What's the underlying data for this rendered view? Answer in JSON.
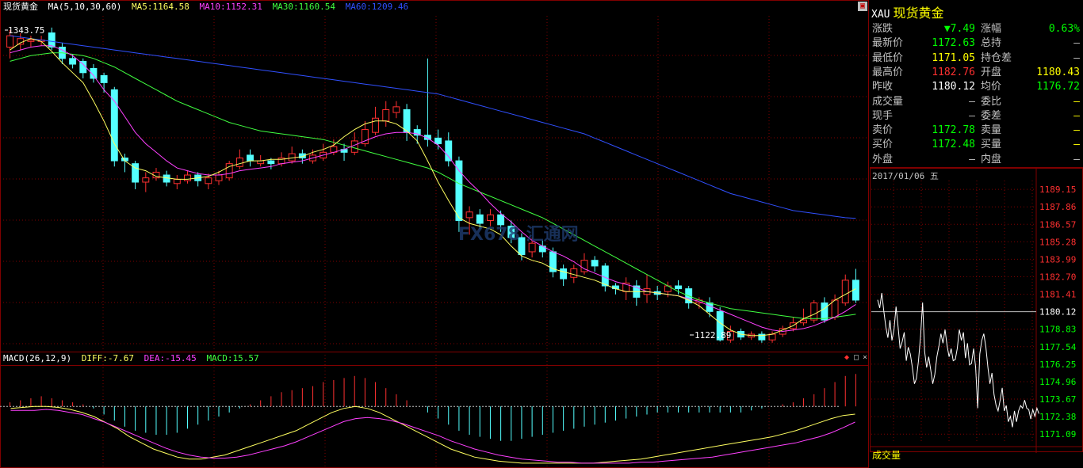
{
  "header": {
    "instrument": "现货黄金",
    "ma_params": "MA(5,10,30,60)",
    "ma5": "MA5:1164.58",
    "ma10": "MA10:1152.31",
    "ma30": "MA30:1160.54",
    "ma60": "MA60:1209.46"
  },
  "annotations": {
    "high_label": "1343.75",
    "low_label": "1122.89"
  },
  "macd_header": {
    "params": "MACD(26,12,9)",
    "diff": "DIFF:-7.67",
    "dea": "DEA:-15.45",
    "macd": "MACD:15.57"
  },
  "quote": {
    "code": "XAU",
    "name": "现货黄金",
    "rows": [
      {
        "l1": "涨跌",
        "v1": "▼7.49",
        "c1": "#00ff00",
        "l2": "涨幅",
        "v2": "0.63%",
        "c2": "#00ff00"
      },
      {
        "l1": "最新价",
        "v1": "1172.63",
        "c1": "#00ff00",
        "l2": "总持",
        "v2": "—",
        "c2": "#c0c0c0"
      },
      {
        "l1": "最低价",
        "v1": "1171.05",
        "c1": "#ffff00",
        "l2": "持仓差",
        "v2": "—",
        "c2": "#c0c0c0"
      },
      {
        "l1": "最高价",
        "v1": "1182.76",
        "c1": "#ff3030",
        "l2": "开盘",
        "v2": "1180.43",
        "c2": "#ffff00"
      },
      {
        "l1": "昨收",
        "v1": "1180.12",
        "c1": "#ffffff",
        "l2": "均价",
        "v2": "1176.72",
        "c2": "#00ff00"
      },
      {
        "l1": "成交量",
        "v1": "—",
        "c1": "#c0c0c0",
        "l2": "委比",
        "v2": "—",
        "c2": "#ffff00"
      },
      {
        "l1": "现手",
        "v1": "—",
        "c1": "#c0c0c0",
        "l2": "委差",
        "v2": "—",
        "c2": "#ffff00"
      },
      {
        "l1": "卖价",
        "v1": "1172.78",
        "c1": "#00ff00",
        "l2": "卖量",
        "v2": "—",
        "c2": "#ffff00"
      },
      {
        "l1": "买价",
        "v1": "1172.48",
        "c1": "#00ff00",
        "l2": "买量",
        "v2": "—",
        "c2": "#ffff00"
      },
      {
        "l1": "外盘",
        "v1": "—",
        "c1": "#c0c0c0",
        "l2": "内盘",
        "v2": "—",
        "c2": "#c0c0c0"
      }
    ]
  },
  "mini": {
    "date": "2017/01/06 五",
    "volume_label": "成交量",
    "watermark": "FX678 汇通网"
  },
  "colors": {
    "up": "#ff3030",
    "down": "#54ffff",
    "ma5": "#ffff60",
    "ma10": "#ff40ff",
    "ma30": "#40ff40",
    "ma60": "#3050ff",
    "grid": "#800000"
  },
  "chart_data": [
    {
      "type": "candlestick",
      "title": "现货黄金",
      "ylim": [
        1118,
        1352
      ],
      "candles": [
        [
          1330,
          1338,
          1322,
          1342
        ],
        [
          1332,
          1336,
          1328,
          1340
        ],
        [
          1334,
          1335,
          1330,
          1338
        ],
        [
          1334,
          1335,
          1331,
          1338
        ],
        [
          1340,
          1330,
          1328,
          1343.75
        ],
        [
          1330,
          1322,
          1318,
          1333
        ],
        [
          1322,
          1318,
          1315,
          1325
        ],
        [
          1320,
          1312,
          1308,
          1322
        ],
        [
          1315,
          1308,
          1305,
          1318
        ],
        [
          1310,
          1305,
          1298,
          1312
        ],
        [
          1300,
          1250,
          1246,
          1302
        ],
        [
          1252,
          1250,
          1242,
          1255
        ],
        [
          1248,
          1235,
          1230,
          1250
        ],
        [
          1235,
          1238,
          1228,
          1242
        ],
        [
          1238,
          1242,
          1236,
          1245
        ],
        [
          1240,
          1235,
          1232,
          1243
        ],
        [
          1234,
          1237,
          1230,
          1240
        ],
        [
          1236,
          1240,
          1234,
          1243
        ],
        [
          1240,
          1236,
          1232,
          1242
        ],
        [
          1234,
          1238,
          1230,
          1241
        ],
        [
          1236,
          1240,
          1233,
          1243
        ],
        [
          1238,
          1248,
          1236,
          1250
        ],
        [
          1246,
          1252,
          1244,
          1258
        ],
        [
          1254,
          1250,
          1246,
          1258
        ],
        [
          1248,
          1250,
          1246,
          1254
        ],
        [
          1250,
          1248,
          1244,
          1252
        ],
        [
          1248,
          1252,
          1246,
          1256
        ],
        [
          1250,
          1255,
          1248,
          1260
        ],
        [
          1255,
          1252,
          1248,
          1258
        ],
        [
          1250,
          1254,
          1248,
          1258
        ],
        [
          1252,
          1256,
          1250,
          1262
        ],
        [
          1256,
          1260,
          1254,
          1265
        ],
        [
          1258,
          1256,
          1250,
          1262
        ],
        [
          1256,
          1264,
          1254,
          1270
        ],
        [
          1262,
          1272,
          1260,
          1278
        ],
        [
          1270,
          1280,
          1268,
          1288
        ],
        [
          1278,
          1286,
          1274,
          1292
        ],
        [
          1284,
          1288,
          1280,
          1292
        ],
        [
          1286,
          1270,
          1264,
          1290
        ],
        [
          1272,
          1268,
          1262,
          1275
        ],
        [
          1268,
          1265,
          1260,
          1322
        ],
        [
          1266,
          1262,
          1258,
          1272
        ],
        [
          1264,
          1250,
          1246,
          1270
        ],
        [
          1250,
          1208,
          1200,
          1253
        ],
        [
          1210,
          1214,
          1198,
          1218
        ],
        [
          1212,
          1206,
          1202,
          1216
        ],
        [
          1208,
          1212,
          1204,
          1216
        ],
        [
          1212,
          1205,
          1200,
          1215
        ],
        [
          1204,
          1196,
          1192,
          1208
        ],
        [
          1196,
          1184,
          1180,
          1199
        ],
        [
          1186,
          1192,
          1182,
          1196
        ],
        [
          1190,
          1186,
          1182,
          1194
        ],
        [
          1186,
          1172,
          1168,
          1189
        ],
        [
          1174,
          1167,
          1162,
          1177
        ],
        [
          1168,
          1174,
          1164,
          1177
        ],
        [
          1172,
          1180,
          1170,
          1185
        ],
        [
          1180,
          1176,
          1172,
          1183
        ],
        [
          1176,
          1162,
          1158,
          1178
        ],
        [
          1162,
          1160,
          1156,
          1164
        ],
        [
          1158,
          1164,
          1152,
          1168
        ],
        [
          1162,
          1154,
          1148,
          1166
        ],
        [
          1156,
          1160,
          1150,
          1170
        ],
        [
          1158,
          1156,
          1152,
          1162
        ],
        [
          1158,
          1162,
          1154,
          1165
        ],
        [
          1162,
          1160,
          1156,
          1166
        ],
        [
          1160,
          1150,
          1146,
          1162
        ],
        [
          1150,
          1152,
          1146,
          1154
        ],
        [
          1150,
          1144,
          1140,
          1154
        ],
        [
          1144,
          1124,
          1122.89,
          1147
        ],
        [
          1124,
          1130,
          1122,
          1134
        ],
        [
          1130,
          1126,
          1124,
          1132
        ],
        [
          1126,
          1128,
          1124,
          1130
        ],
        [
          1128,
          1124,
          1122,
          1130
        ],
        [
          1124,
          1128,
          1122,
          1130
        ],
        [
          1128,
          1132,
          1126,
          1134
        ],
        [
          1132,
          1136,
          1130,
          1140
        ],
        [
          1136,
          1138,
          1134,
          1146
        ],
        [
          1138,
          1150,
          1136,
          1152
        ],
        [
          1150,
          1138,
          1136,
          1154
        ],
        [
          1140,
          1152,
          1138,
          1156
        ],
        [
          1150,
          1166,
          1148,
          1170
        ],
        [
          1166,
          1152,
          1150,
          1174
        ]
      ],
      "ma5": [
        1328,
        1333,
        1336,
        1334,
        1327,
        1319,
        1312,
        1305,
        1292,
        1278,
        1262,
        1250,
        1245,
        1243,
        1239,
        1238,
        1237,
        1237,
        1238,
        1239,
        1242,
        1246,
        1248,
        1250,
        1250,
        1251,
        1251,
        1252,
        1253,
        1256,
        1258,
        1261,
        1267,
        1272,
        1276,
        1278,
        1278,
        1276,
        1271,
        1264,
        1250,
        1235,
        1222,
        1210,
        1206,
        1204,
        1202,
        1198,
        1190,
        1183,
        1180,
        1178,
        1174,
        1172,
        1170,
        1168,
        1166,
        1163,
        1160,
        1158,
        1158,
        1158,
        1157,
        1156,
        1155,
        1152,
        1148,
        1142,
        1136,
        1131,
        1128,
        1127,
        1127,
        1128,
        1131,
        1134,
        1139,
        1142,
        1146,
        1152,
        1156,
        1160
      ],
      "ma10": [
        1326,
        1328,
        1330,
        1331,
        1331,
        1328,
        1324,
        1318,
        1310,
        1300,
        1292,
        1281,
        1270,
        1262,
        1256,
        1250,
        1245,
        1243,
        1241,
        1240,
        1240,
        1241,
        1243,
        1244,
        1245,
        1246,
        1248,
        1249,
        1250,
        1252,
        1254,
        1256,
        1258,
        1261,
        1264,
        1267,
        1269,
        1270,
        1270,
        1269,
        1266,
        1261,
        1253,
        1243,
        1235,
        1228,
        1220,
        1213,
        1207,
        1200,
        1194,
        1190,
        1186,
        1183,
        1179,
        1174,
        1171,
        1168,
        1165,
        1163,
        1161,
        1158,
        1157,
        1156,
        1155,
        1153,
        1151,
        1148,
        1145,
        1142,
        1139,
        1136,
        1133,
        1131,
        1130,
        1131,
        1132,
        1134,
        1137,
        1140,
        1144,
        1149
      ],
      "ma30": [
        1320,
        1322,
        1324,
        1325,
        1326,
        1326,
        1325,
        1324,
        1322,
        1319,
        1316,
        1312,
        1308,
        1304,
        1300,
        1296,
        1292,
        1289,
        1286,
        1283,
        1280,
        1277,
        1275,
        1273,
        1271,
        1270,
        1269,
        1268,
        1267,
        1266,
        1265,
        1263,
        1261,
        1259,
        1257,
        1255,
        1253,
        1251,
        1249,
        1247,
        1245,
        1242,
        1238,
        1234,
        1231,
        1228,
        1225,
        1222,
        1219,
        1216,
        1213,
        1210,
        1206,
        1202,
        1198,
        1194,
        1190,
        1186,
        1182,
        1178,
        1174,
        1170,
        1166,
        1162,
        1158,
        1155,
        1152,
        1150,
        1148,
        1146,
        1145,
        1144,
        1143,
        1142,
        1141,
        1140,
        1139,
        1139,
        1139,
        1140,
        1141,
        1142
      ],
      "ma60": [
        1338,
        1337,
        1336,
        1335,
        1334,
        1333,
        1332,
        1331,
        1330,
        1329,
        1328,
        1327,
        1326,
        1325,
        1324,
        1323,
        1322,
        1321,
        1320,
        1319,
        1318,
        1317,
        1316,
        1315,
        1314,
        1313,
        1312,
        1311,
        1310,
        1309,
        1308,
        1307,
        1306,
        1305,
        1304,
        1303,
        1302,
        1301,
        1300,
        1299,
        1298,
        1297,
        1295,
        1293,
        1291,
        1289,
        1287,
        1285,
        1283,
        1281,
        1279,
        1277,
        1275,
        1273,
        1271,
        1269,
        1266,
        1263,
        1260,
        1257,
        1254,
        1251,
        1248,
        1245,
        1242,
        1239,
        1236,
        1233,
        1230,
        1227,
        1225,
        1223,
        1221,
        1219,
        1217,
        1215,
        1214,
        1213,
        1212,
        1211,
        1210,
        1209.46
      ]
    },
    {
      "type": "bar",
      "title": "MACD(26,12,9)",
      "ylim": [
        -60,
        40
      ],
      "macd": [
        4,
        6,
        8,
        10,
        8,
        6,
        4,
        2,
        -2,
        -8,
        -14,
        -20,
        -24,
        -26,
        -28,
        -28,
        -26,
        -22,
        -18,
        -14,
        -10,
        -6,
        -2,
        2,
        6,
        10,
        14,
        16,
        18,
        20,
        24,
        26,
        28,
        30,
        28,
        24,
        18,
        12,
        6,
        0,
        -6,
        -12,
        -18,
        -24,
        -28,
        -30,
        -32,
        -34,
        -34,
        -32,
        -30,
        -28,
        -26,
        -24,
        -22,
        -20,
        -18,
        -16,
        -14,
        -12,
        -10,
        -8,
        -6,
        -6,
        -6,
        -6,
        -6,
        -6,
        -6,
        -6,
        -6,
        -4,
        -2,
        0,
        2,
        4,
        8,
        12,
        18,
        24,
        30,
        32
      ],
      "diff": [
        -2,
        -1,
        0,
        0,
        -1,
        -3,
        -6,
        -10,
        -16,
        -22,
        -30,
        -36,
        -42,
        -46,
        -50,
        -52,
        -52,
        -50,
        -48,
        -44,
        -40,
        -36,
        -32,
        -28,
        -24,
        -18,
        -12,
        -6,
        -2,
        0,
        -2,
        -6,
        -12,
        -18,
        -24,
        -30,
        -36,
        -42,
        -46,
        -50,
        -52,
        -54,
        -55,
        -56,
        -56,
        -56,
        -56,
        -56,
        -56,
        -56,
        -55,
        -54,
        -53,
        -52,
        -50,
        -48,
        -46,
        -44,
        -42,
        -40,
        -38,
        -36,
        -34,
        -32,
        -30,
        -27,
        -24,
        -20,
        -16,
        -12,
        -9,
        -7.67
      ],
      "dea": [
        -4,
        -4,
        -4,
        -3,
        -4,
        -6,
        -8,
        -12,
        -16,
        -21,
        -26,
        -31,
        -36,
        -41,
        -45,
        -48,
        -50,
        -51,
        -51,
        -50,
        -48,
        -45,
        -42,
        -39,
        -35,
        -30,
        -25,
        -20,
        -15,
        -12,
        -11,
        -12,
        -14,
        -17,
        -21,
        -25,
        -29,
        -34,
        -38,
        -42,
        -45,
        -48,
        -50,
        -52,
        -53,
        -54,
        -55,
        -55,
        -56,
        -56,
        -56,
        -56,
        -56,
        -55,
        -55,
        -54,
        -53,
        -52,
        -51,
        -50,
        -48,
        -46,
        -44,
        -42,
        -40,
        -38,
        -36,
        -33,
        -30,
        -26,
        -21,
        -15.45
      ]
    },
    {
      "type": "line",
      "title": "2017/01/06 五",
      "yticks": [
        "1189.15",
        "1187.86",
        "1186.57",
        "1185.28",
        "1183.99",
        "1182.70",
        "1181.41",
        "1180.12",
        "1178.83",
        "1177.54",
        "1176.25",
        "1174.96",
        "1173.67",
        "1172.38",
        "1171.09"
      ],
      "ylim": [
        1170.4,
        1189.8
      ],
      "reference": 1180.12,
      "values": [
        1181.0,
        1180.4,
        1181.5,
        1180.2,
        1179.0,
        1178.2,
        1179.5,
        1178.0,
        1178.8,
        1180.5,
        1179.0,
        1177.4,
        1177.9,
        1178.6,
        1176.5,
        1177.5,
        1177.0,
        1176.0,
        1174.8,
        1175.2,
        1176.5,
        1178.3,
        1180.8,
        1177.2,
        1176.0,
        1176.8,
        1175.8,
        1174.8,
        1175.5,
        1176.8,
        1177.6,
        1178.5,
        1177.8,
        1178.8,
        1177.6,
        1176.8,
        1177.4,
        1176.5,
        1176.6,
        1177.4,
        1178.8,
        1178.0,
        1178.6,
        1176.7,
        1177.8,
        1176.2,
        1176.3,
        1177.4,
        1176.0,
        1173.0,
        1177.0,
        1178.0,
        1178.5,
        1177.5,
        1176.0,
        1174.8,
        1175.6,
        1174.0,
        1173.2,
        1172.8,
        1173.6,
        1174.5,
        1172.8,
        1173.2,
        1172.0,
        1172.4,
        1171.6,
        1172.8,
        1172.0,
        1172.8,
        1173.2,
        1173.0,
        1173.6,
        1173.0,
        1172.9,
        1172.2,
        1172.9,
        1172.4,
        1173.0,
        1172.6
      ]
    }
  ]
}
